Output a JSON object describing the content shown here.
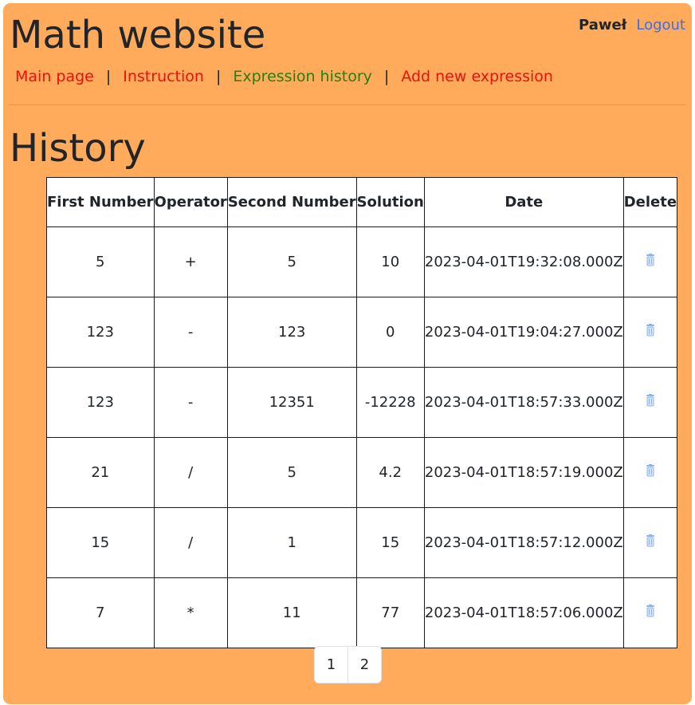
{
  "header": {
    "site_title": "Math website",
    "user_name": "Paweł",
    "logout_label": "Logout"
  },
  "nav": {
    "items": [
      {
        "label": "Main page",
        "color": "#e8120c"
      },
      {
        "label": "Instruction",
        "color": "#e8120c"
      },
      {
        "label": "Expression history",
        "color": "#2a7d0b",
        "active": true
      },
      {
        "label": "Add new expression",
        "color": "#e8120c"
      }
    ],
    "separator": "|"
  },
  "main": {
    "page_title": "History",
    "table": {
      "headers": [
        "First Number",
        "Operator",
        "Second Number",
        "Solution",
        "Date",
        "Delete"
      ],
      "rows": [
        {
          "first": "5",
          "op": "+",
          "second": "5",
          "solution": "10",
          "date": "2023-04-01T19:32:08.000Z",
          "delete_icon": "trash-icon"
        },
        {
          "first": "123",
          "op": "-",
          "second": "123",
          "solution": "0",
          "date": "2023-04-01T19:04:27.000Z",
          "delete_icon": "trash-icon"
        },
        {
          "first": "123",
          "op": "-",
          "second": "12351",
          "solution": "-12228",
          "date": "2023-04-01T18:57:33.000Z",
          "delete_icon": "trash-icon"
        },
        {
          "first": "21",
          "op": "/",
          "second": "5",
          "solution": "4.2",
          "date": "2023-04-01T18:57:19.000Z",
          "delete_icon": "trash-icon"
        },
        {
          "first": "15",
          "op": "/",
          "second": "1",
          "solution": "15",
          "date": "2023-04-01T18:57:12.000Z",
          "delete_icon": "trash-icon"
        },
        {
          "first": "7",
          "op": "*",
          "second": "11",
          "solution": "77",
          "date": "2023-04-01T18:57:06.000Z",
          "delete_icon": "trash-icon"
        }
      ]
    },
    "pagination": [
      "1",
      "2"
    ]
  },
  "colors": {
    "panel_background": "#ffab5b",
    "link_red": "#e8120c",
    "link_green": "#2a7d0b",
    "logout_blue": "#3a6ee8",
    "trash_icon": "#8fb3f0"
  }
}
